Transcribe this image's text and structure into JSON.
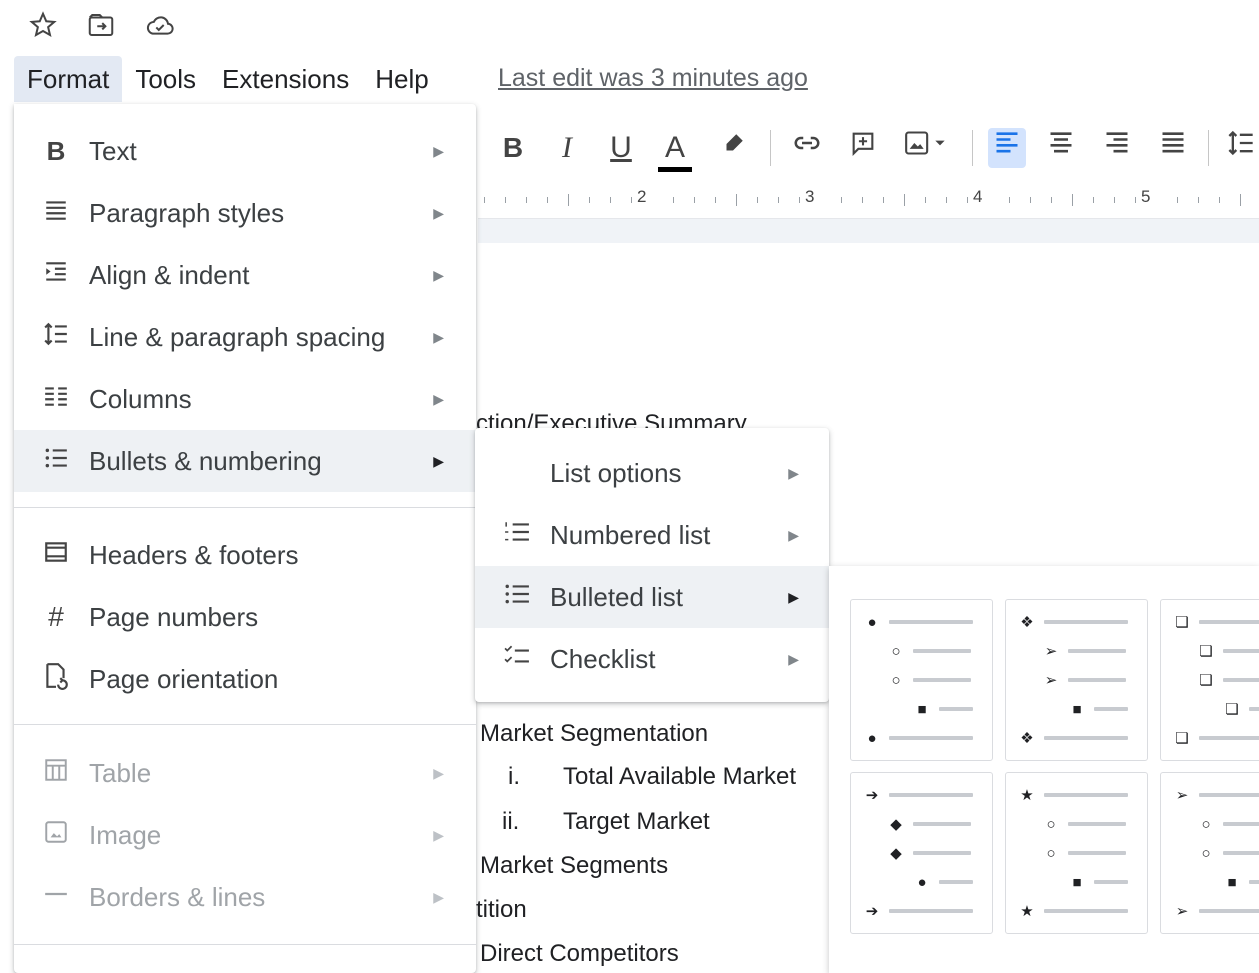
{
  "top_icons": [
    "star-icon",
    "move-to-folder-icon",
    "cloud-saved-icon"
  ],
  "menubar": {
    "items": [
      "Format",
      "Tools",
      "Extensions",
      "Help"
    ],
    "last_edit": "Last edit was 3 minutes ago"
  },
  "ruler": {
    "numbers": [
      "2",
      "3",
      "4",
      "5"
    ]
  },
  "format_menu": {
    "items": [
      {
        "icon": "bold-icon",
        "label": "Text",
        "submenu": true,
        "disabled": false
      },
      {
        "icon": "paragraph-styles-icon",
        "label": "Paragraph styles",
        "submenu": true,
        "disabled": false
      },
      {
        "icon": "indent-icon",
        "label": "Align & indent",
        "submenu": true,
        "disabled": false
      },
      {
        "icon": "line-spacing-icon",
        "label": "Line & paragraph spacing",
        "submenu": true,
        "disabled": false
      },
      {
        "icon": "columns-icon",
        "label": "Columns",
        "submenu": true,
        "disabled": false
      },
      {
        "icon": "bullets-icon",
        "label": "Bullets & numbering",
        "submenu": true,
        "disabled": false,
        "highlighted": true
      },
      {
        "icon": "headers-footers-icon",
        "label": "Headers & footers",
        "submenu": false,
        "disabled": false
      },
      {
        "icon": "hash-icon",
        "label": "Page numbers",
        "submenu": false,
        "disabled": false
      },
      {
        "icon": "page-orientation-icon",
        "label": "Page orientation",
        "submenu": false,
        "disabled": false
      },
      {
        "icon": "table-icon",
        "label": "Table",
        "submenu": true,
        "disabled": true
      },
      {
        "icon": "image-icon",
        "label": "Image",
        "submenu": true,
        "disabled": true
      },
      {
        "icon": "borders-lines-icon",
        "label": "Borders & lines",
        "submenu": true,
        "disabled": true
      }
    ]
  },
  "bullets_submenu": {
    "items": [
      {
        "icon": "",
        "label": "List options"
      },
      {
        "icon": "numbered-list-icon",
        "label": "Numbered list"
      },
      {
        "icon": "bulleted-list-icon",
        "label": "Bulleted list",
        "highlighted": true
      },
      {
        "icon": "checklist-icon",
        "label": "Checklist"
      }
    ]
  },
  "bullet_presets": [
    [
      "●",
      "○",
      "○",
      "■",
      "●"
    ],
    [
      "❖",
      "➢",
      "➢",
      "■",
      "❖"
    ],
    [
      "❏",
      "❏",
      "❏",
      "❏",
      "❏"
    ],
    [
      "➔",
      "◆",
      "◆",
      "●",
      "➔"
    ],
    [
      "★",
      "○",
      "○",
      "■",
      "★"
    ],
    [
      "➢",
      "○",
      "○",
      "■",
      "➢"
    ]
  ],
  "document": {
    "lines": [
      "ction/Executive Summary",
      "Market Segmentation",
      "i.",
      "Total Available Market",
      "ii.",
      "Target Market",
      "Market Segments",
      "tition",
      "Direct Competitors"
    ]
  },
  "colors": {
    "accent": "#1a73e8",
    "menu_highlight": "#eef1f4",
    "active_menu": "#e3e9f3"
  }
}
